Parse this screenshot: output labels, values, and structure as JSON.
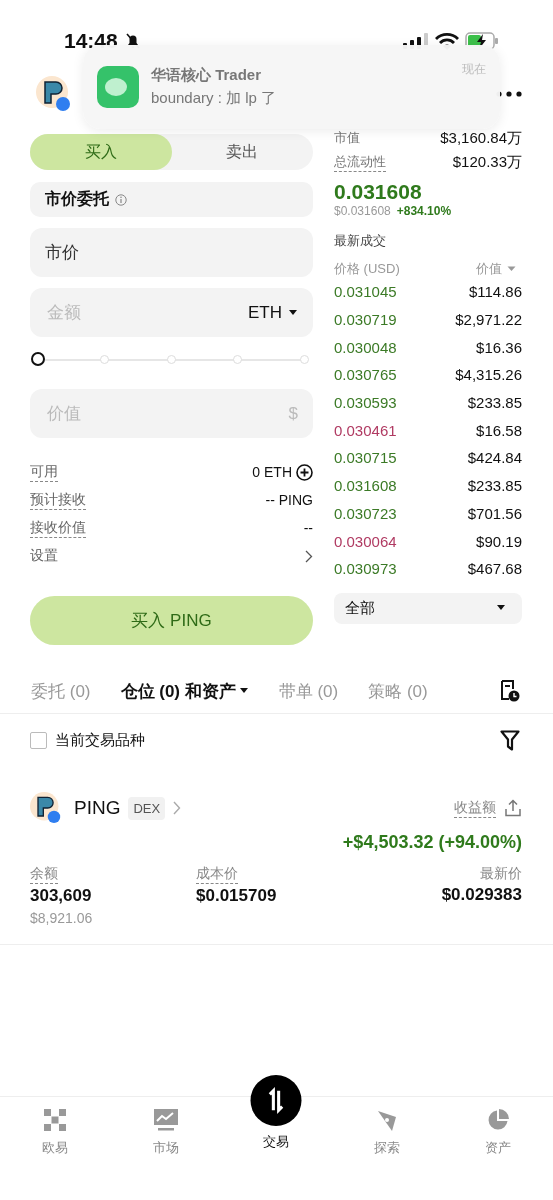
{
  "status_bar": {
    "time": "14:48"
  },
  "notification": {
    "app": "华语核心 Trader",
    "message": "boundary : 加 lp 了",
    "time": "现在"
  },
  "side_tabs": [
    {
      "label": "买入",
      "selected": true
    },
    {
      "label": "卖出",
      "selected": false
    }
  ],
  "order_type": "市价委托",
  "price_field": {
    "value": "市价"
  },
  "amount_field": {
    "placeholder": "金额",
    "unit": "ETH"
  },
  "slider": {
    "level": 0
  },
  "value_field": {
    "placeholder": "价值",
    "unit": "$"
  },
  "info_rows": [
    {
      "kind": "add",
      "label": "可用",
      "hint": true,
      "value": "0 ETH"
    },
    {
      "kind": "text",
      "label": "预计接收",
      "hint": true,
      "value": "-- PING"
    },
    {
      "kind": "text",
      "label": "接收价值",
      "hint": true,
      "value": "--"
    },
    {
      "kind": "link",
      "label": "设置",
      "hint": false
    }
  ],
  "submit_button": "买入 PING",
  "stats": [
    {
      "label": "市值",
      "hint": false,
      "value": "$3,160.84万"
    },
    {
      "label": "总流动性",
      "hint": true,
      "value": "$120.33万"
    }
  ],
  "last_price": "0.031608",
  "usd_price": "$0.031608",
  "change": "+834.10%",
  "trades": {
    "title": "最新成交",
    "columns": [
      "价格 (USD)",
      "价值"
    ],
    "rows": [
      {
        "price": "0.031045",
        "value": "$114.86",
        "color": "#3b7a26"
      },
      {
        "price": "0.030719",
        "value": "$2,971.22",
        "color": "#3b7a26"
      },
      {
        "price": "0.030048",
        "value": "$16.36",
        "color": "#3b7a26"
      },
      {
        "price": "0.030765",
        "value": "$4,315.26",
        "color": "#3b7a26"
      },
      {
        "price": "0.030593",
        "value": "$233.85",
        "color": "#3b7a26"
      },
      {
        "price": "0.030461",
        "value": "$16.58",
        "color": "#b03a62"
      },
      {
        "price": "0.030715",
        "value": "$424.84",
        "color": "#3b7a26"
      },
      {
        "price": "0.031608",
        "value": "$233.85",
        "color": "#3b7a26"
      },
      {
        "price": "0.030723",
        "value": "$701.56",
        "color": "#3b7a26"
      },
      {
        "price": "0.030064",
        "value": "$90.19",
        "color": "#b03a62"
      },
      {
        "price": "0.030973",
        "value": "$467.68",
        "color": "#3b7a26"
      }
    ]
  },
  "trade_filter": "全部",
  "bottom_tabs": [
    {
      "label": "委托 (0)",
      "selected": false
    },
    {
      "label": "仓位 (0) 和资产",
      "selected": true
    },
    {
      "label": "带单 (0)",
      "selected": false
    },
    {
      "label": "策略 (0)",
      "selected": false
    }
  ],
  "filter_checkbox": {
    "label": "当前交易品种",
    "checked": false
  },
  "position": {
    "symbol": "PING",
    "badge": "DEX",
    "pnl_label": "收益额",
    "pnl": "+$4,503.32 (+94.00%)",
    "fields": [
      {
        "label": "余额",
        "hint": true,
        "value": "303,609",
        "sub": "$8,921.06"
      },
      {
        "label": "成本价",
        "hint": true,
        "value": "$0.015709"
      },
      {
        "label": "最新价",
        "hint": false,
        "value": "$0.029383"
      }
    ]
  },
  "nav": [
    {
      "kind": "home",
      "label": "欧易",
      "selected": false
    },
    {
      "kind": "market",
      "label": "市场",
      "selected": false
    },
    {
      "kind": "trade",
      "label": "交易",
      "selected": true
    },
    {
      "kind": "explore",
      "label": "探索",
      "selected": false
    },
    {
      "kind": "assets",
      "label": "资产",
      "selected": false
    }
  ]
}
